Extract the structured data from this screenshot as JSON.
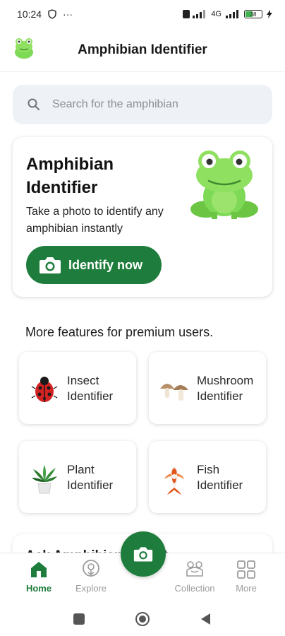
{
  "status_bar": {
    "time": "10:24",
    "dots": "···",
    "network": "4G",
    "battery": "38"
  },
  "app_bar": {
    "title": "Amphibian Identifier"
  },
  "search": {
    "placeholder": "Search for the amphibian"
  },
  "hero": {
    "title": "Amphibian Identifier",
    "subtitle": "Take a photo to identify any amphibian instantly",
    "button_label": "Identify now"
  },
  "premium": {
    "heading": "More features for premium users.",
    "features": [
      {
        "label": "Insect Identifier",
        "icon": "ladybug-icon"
      },
      {
        "label": "Mushroom Identifier",
        "icon": "mushroom-icon"
      },
      {
        "label": "Plant Identifier",
        "icon": "potted-plant-icon"
      },
      {
        "label": "Fish Identifier",
        "icon": "koi-fish-icon"
      }
    ]
  },
  "ask_card": {
    "title": "Ask Amphibian Expert"
  },
  "bottom_nav": {
    "items": [
      {
        "label": "Home",
        "icon": "home-icon",
        "active": true
      },
      {
        "label": "Explore",
        "icon": "explore-icon",
        "active": false
      },
      {
        "label": "Collection",
        "icon": "collection-icon",
        "active": false
      },
      {
        "label": "More",
        "icon": "grid-icon",
        "active": false
      }
    ]
  },
  "colors": {
    "primary": "#1e7d3c",
    "frog_green": "#7ed957",
    "search_bg": "#eef2f7"
  }
}
